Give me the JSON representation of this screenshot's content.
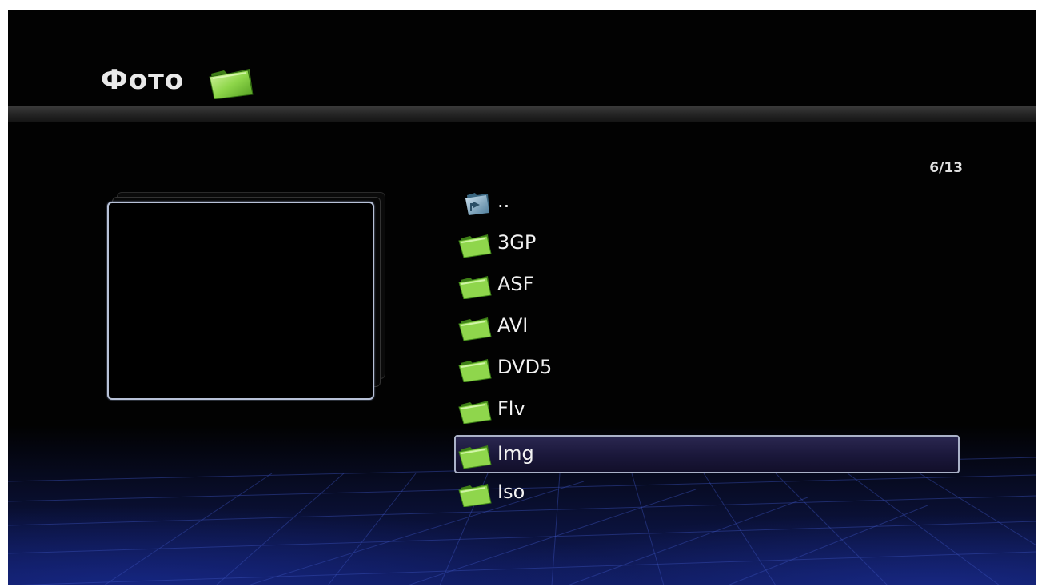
{
  "header": {
    "title": "Фото",
    "title_icon": "folder-icon"
  },
  "counter": "6/13",
  "preview": {
    "state": "empty"
  },
  "file_list": [
    {
      "label": "..",
      "icon": "parent-folder-icon",
      "selected": false
    },
    {
      "label": "3GP",
      "icon": "folder-icon",
      "selected": false
    },
    {
      "label": "ASF",
      "icon": "folder-icon",
      "selected": false
    },
    {
      "label": "AVI",
      "icon": "folder-icon",
      "selected": false
    },
    {
      "label": "DVD5",
      "icon": "folder-icon",
      "selected": false
    },
    {
      "label": "Flv",
      "icon": "folder-icon",
      "selected": false
    },
    {
      "label": "Img",
      "icon": "folder-icon",
      "selected": true
    },
    {
      "label": "Iso",
      "icon": "folder-icon",
      "selected": false
    }
  ],
  "colors": {
    "background": "#020202",
    "selection": "#1a173a",
    "selection_border": "#aab2c8",
    "folder": "#7cd43a",
    "floor_grid": "#1a2a8a"
  }
}
